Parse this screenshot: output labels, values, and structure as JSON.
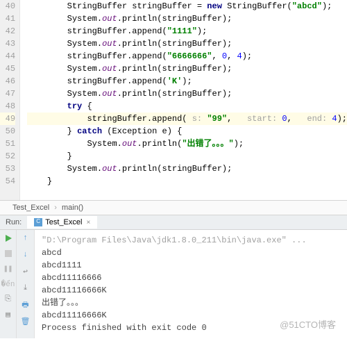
{
  "gutter": [
    "40",
    "41",
    "42",
    "43",
    "44",
    "45",
    "46",
    "47",
    "48",
    "49",
    "50",
    "51",
    "52",
    "53",
    "54",
    ""
  ],
  "code": {
    "l40": {
      "i0": "        ",
      "t1": "StringBuffer stringBuffer = ",
      "kw": "new",
      "t2": " StringBuffer(",
      "s": "\"abcd\"",
      "t3": ");"
    },
    "l41": {
      "i0": "        ",
      "t1": "System.",
      "f": "out",
      "t2": ".println(stringBuffer);"
    },
    "l42": {
      "i0": "        ",
      "t1": "stringBuffer.append(",
      "s": "\"1111\"",
      "t2": ");"
    },
    "l43": {
      "i0": "        ",
      "t1": "System.",
      "f": "out",
      "t2": ".println(stringBuffer);"
    },
    "l44": {
      "i0": "        ",
      "t1": "stringBuffer.append(",
      "s": "\"6666666\"",
      "t2": ", ",
      "n1": "0",
      "t3": ", ",
      "n2": "4",
      "t4": ");"
    },
    "l45": {
      "i0": "        ",
      "t1": "System.",
      "f": "out",
      "t2": ".println(stringBuffer);"
    },
    "l46": {
      "i0": "        ",
      "t1": "stringBuffer.append(",
      "c": "'K'",
      "t2": ");"
    },
    "l47": {
      "i0": "        ",
      "t1": "System.",
      "f": "out",
      "t2": ".println(stringBuffer);"
    },
    "l48": {
      "i0": "        ",
      "kw": "try",
      "t1": " {"
    },
    "l49": {
      "i0": "            ",
      "t1": "stringBuffer.append( ",
      "h1": "s: ",
      "s": "\"99\"",
      "t2": ",   ",
      "h2": "start: ",
      "n1": "0",
      "t3": ",   ",
      "h3": "end: ",
      "n2": "4",
      "t4": ");"
    },
    "l50": {
      "i0": "        ",
      "t1": "} ",
      "kw": "catch",
      "t2": " (Exception e) {"
    },
    "l51": {
      "i0": "            ",
      "t1": "System.",
      "f": "out",
      "t2": ".println(",
      "s": "\"出错了。。。\"",
      "t3": ");"
    },
    "l52": {
      "i0": "        ",
      "t1": "}"
    },
    "l53": {
      "i0": "        ",
      "t1": "System.",
      "f": "out",
      "t2": ".println(stringBuffer);"
    },
    "l54": {
      "i0": "    ",
      "t1": "}"
    }
  },
  "breadcrumb": {
    "a": "Test_Excel",
    "b": "main()"
  },
  "run": {
    "label": "Run:",
    "tab": "Test_Excel",
    "cmdline": "\"D:\\Program Files\\Java\\jdk1.8.0_211\\bin\\java.exe\" ...",
    "out": [
      "abcd",
      "abcd1111",
      "abcd11116666",
      "abcd11116666K",
      "出错了。。。",
      "abcd11116666K",
      "",
      "Process finished with exit code 0"
    ]
  },
  "watermark": "@51CTO博客"
}
